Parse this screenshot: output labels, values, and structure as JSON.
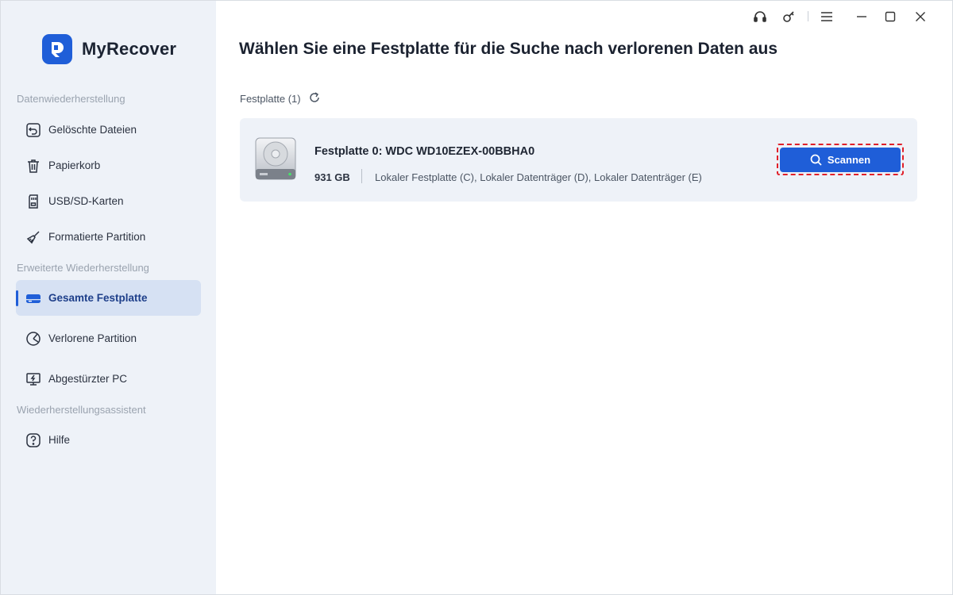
{
  "app": {
    "name": "MyRecover"
  },
  "sidebar": {
    "sections": [
      {
        "title": "Datenwiederherstellung"
      },
      {
        "title": "Erweiterte Wiederherstellung"
      },
      {
        "title": "Wiederherstellungsassistent"
      }
    ],
    "items": [
      {
        "label": "Gelöschte Dateien",
        "icon": "undo-icon"
      },
      {
        "label": "Papierkorb",
        "icon": "trash-icon"
      },
      {
        "label": "USB/SD-Karten",
        "icon": "sd-card-icon"
      },
      {
        "label": "Formatierte Partition",
        "icon": "broom-icon"
      },
      {
        "label": "Gesamte Festplatte",
        "icon": "hard-drive-icon",
        "active": true
      },
      {
        "label": "Verlorene Partition",
        "icon": "pie-partition-icon"
      },
      {
        "label": "Abgestürzter PC",
        "icon": "crashed-monitor-icon"
      },
      {
        "label": "Hilfe",
        "icon": "help-icon"
      }
    ]
  },
  "topbar": {
    "icons": [
      "headset-icon",
      "key-icon",
      "menu-icon",
      "minimize-icon",
      "maximize-icon",
      "close-icon"
    ]
  },
  "main": {
    "title": "Wählen Sie eine Festplatte für die Suche nach verlorenen Daten aus",
    "disk_count_label": "Festplatte (1)",
    "disks": [
      {
        "name": "Festplatte 0: WDC WD10EZEX-00BBHA0",
        "size": "931 GB",
        "partitions": "Lokaler Festplatte (C), Lokaler Datenträger (D), Lokaler Datenträger (E)",
        "scan_label": "Scannen"
      }
    ]
  },
  "colors": {
    "accent": "#1f5ed8",
    "sidebar_bg": "#eef2f8",
    "active_item_bg": "#d6e1f3",
    "highlight": "#e0202a"
  }
}
